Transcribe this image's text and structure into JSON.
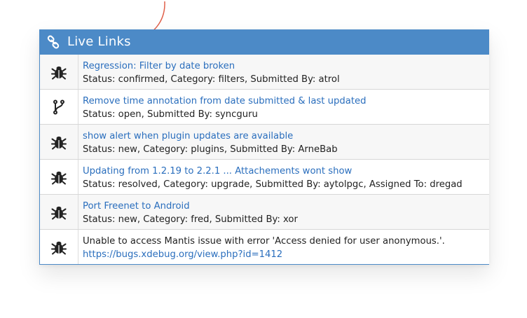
{
  "header": {
    "title": "Live Links",
    "icon": "link-icon",
    "color": "#4c8ac7"
  },
  "rows": [
    {
      "icon": "bug-icon",
      "title": "Regression: Filter by date broken",
      "status": "Status: confirmed, Category: filters, Submitted By: atrol"
    },
    {
      "icon": "git-branch-icon",
      "title": "Remove time annotation from date submitted & last updated",
      "status": "Status: open, Submitted By: syncguru"
    },
    {
      "icon": "bug-icon",
      "title": "show alert when plugin updates are available",
      "status": "Status: new, Category: plugins, Submitted By: ArneBab"
    },
    {
      "icon": "bug-icon",
      "title": "Updating from 1.2.19 to 2.2.1 ... Attachements wont show",
      "status": "Status: resolved, Category: upgrade, Submitted By: aytolpgc, Assigned To: dregad"
    },
    {
      "icon": "bug-icon",
      "title": "Port Freenet to Android",
      "status": "Status: new, Category: fred, Submitted By: xor"
    },
    {
      "icon": "bug-icon",
      "error": "Unable to access Mantis issue with error 'Access denied for user anonymous.'.",
      "link": "https://bugs.xdebug.org/view.php?id=1412"
    }
  ],
  "colors": {
    "link": "#2a6ebd",
    "arrow": "#e0604a"
  }
}
